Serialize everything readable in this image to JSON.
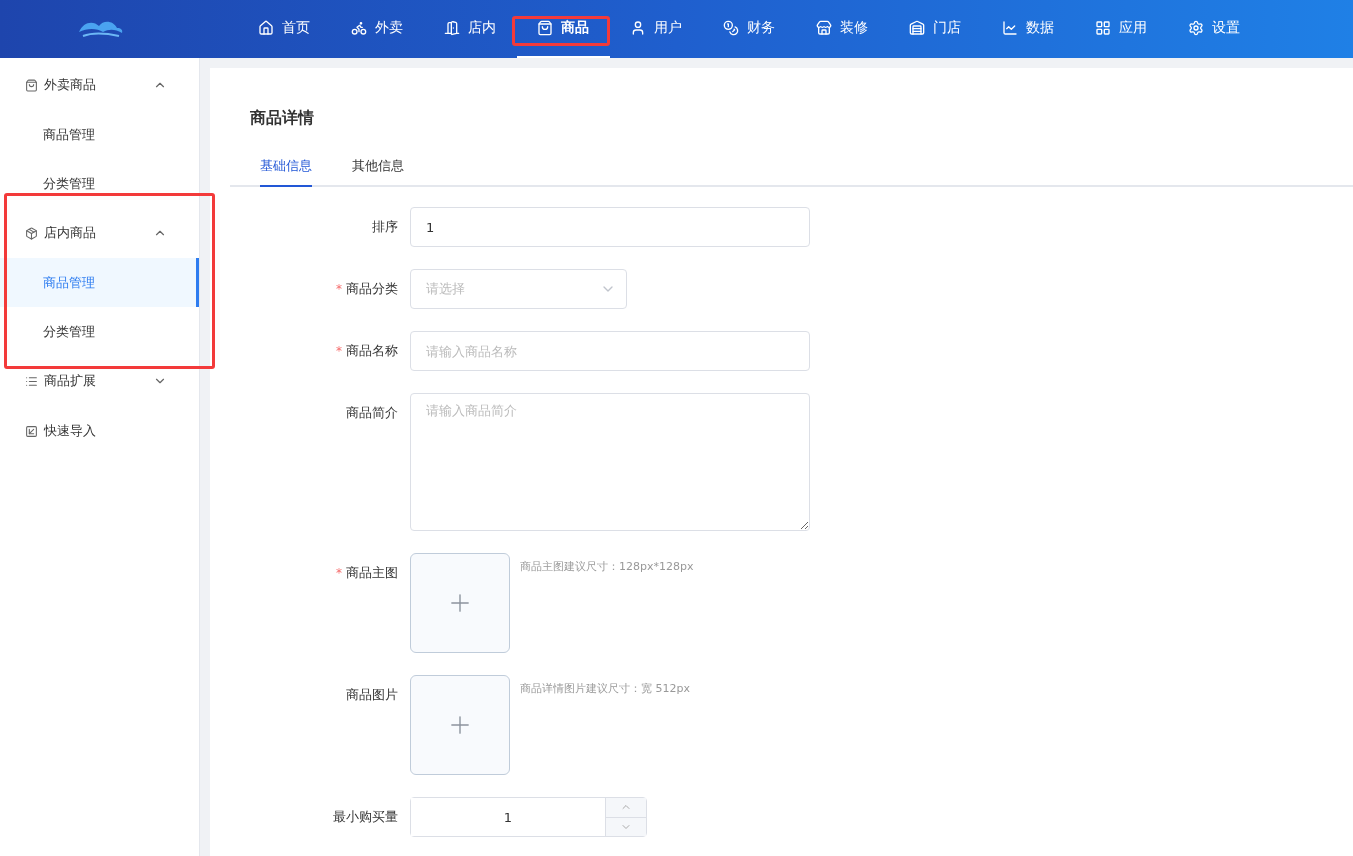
{
  "nav": [
    {
      "label": "首页",
      "selected": false,
      "highlighted": false
    },
    {
      "label": "外卖",
      "selected": false,
      "highlighted": false
    },
    {
      "label": "店内",
      "selected": false,
      "highlighted": false
    },
    {
      "label": "商品",
      "selected": true,
      "highlighted": true
    },
    {
      "label": "用户",
      "selected": false,
      "highlighted": false
    },
    {
      "label": "财务",
      "selected": false,
      "highlighted": false
    },
    {
      "label": "装修",
      "selected": false,
      "highlighted": false
    },
    {
      "label": "门店",
      "selected": false,
      "highlighted": false
    },
    {
      "label": "数据",
      "selected": false,
      "highlighted": false
    },
    {
      "label": "应用",
      "selected": false,
      "highlighted": false
    },
    {
      "label": "设置",
      "selected": false,
      "highlighted": false
    }
  ],
  "sidebar": {
    "items": [
      {
        "label": "外卖商品",
        "expanded": true,
        "highlighted": false,
        "children": [
          {
            "label": "商品管理",
            "selected": false
          },
          {
            "label": "分类管理",
            "selected": false
          }
        ]
      },
      {
        "label": "店内商品",
        "expanded": true,
        "highlighted": true,
        "children": [
          {
            "label": "商品管理",
            "selected": true
          },
          {
            "label": "分类管理",
            "selected": false
          }
        ]
      },
      {
        "label": "商品扩展",
        "expanded": false,
        "highlighted": false
      },
      {
        "label": "快速导入",
        "highlighted": false
      }
    ]
  },
  "page": {
    "title": "商品详情",
    "tabs": [
      {
        "label": "基础信息",
        "selected": true
      },
      {
        "label": "其他信息",
        "selected": false
      }
    ],
    "fields": [
      {
        "kind": "input",
        "label": "排序",
        "value": "1"
      },
      {
        "kind": "select",
        "label": "商品分类",
        "required_mark": "*",
        "placeholder": "请选择"
      },
      {
        "kind": "input",
        "label": "商品名称",
        "required_mark": "*",
        "placeholder": "请输入商品名称"
      },
      {
        "kind": "textarea",
        "label": "商品简介",
        "placeholder": "请输入商品简介"
      },
      {
        "kind": "upload",
        "label": "商品主图",
        "required_mark": "*",
        "hint": "商品主图建议尺寸：128px*128px"
      },
      {
        "kind": "upload",
        "label": "商品图片",
        "hint": "商品详情图片建议尺寸：宽 512px"
      },
      {
        "kind": "number",
        "label": "最小购买量",
        "value": "1"
      }
    ]
  }
}
